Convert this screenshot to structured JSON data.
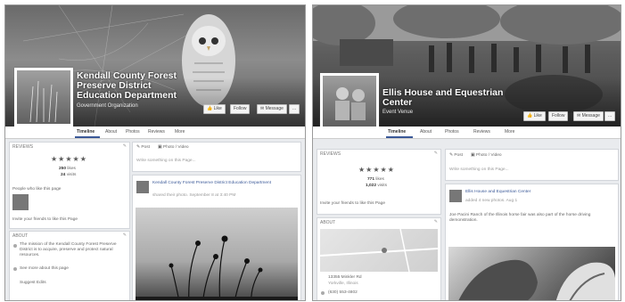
{
  "pageA": {
    "name": "Kendall County Forest Preserve District Education Department",
    "category": "Government Organization",
    "cover_buttons": {
      "like": "Like",
      "follow": "Follow",
      "message": "Message",
      "more": "..."
    },
    "tabs": [
      "Timeline",
      "About",
      "Photos",
      "Reviews",
      "More"
    ],
    "reviews": {
      "header": "REVIEWS",
      "stars": "★★★★★",
      "stat1_value": "250",
      "stat1_label": "likes",
      "stat2_value": "24",
      "stat2_label": "visits",
      "people_like": "People who like this page",
      "invite": "Invite your friends to like this Page"
    },
    "about": {
      "header": "ABOUT",
      "desc": "The mission of the Kendall County Forest Preserve District is to acquire, preserve and protect natural resources.",
      "link": "See more about this page",
      "suggest": "Suggest Edits"
    },
    "composer": {
      "post": "Post",
      "photo": "Photo / Video",
      "placeholder": "Write something on this Page..."
    },
    "post": {
      "author": "Kendall County Forest Preserve District Education Department",
      "meta": "shared their photo. September 8 at 3:40 PM"
    }
  },
  "pageB": {
    "name": "Ellis House and Equestrian Center",
    "category": "Event Venue",
    "cover_buttons": {
      "like": "Like",
      "follow": "Follow",
      "message": "Message",
      "more": "..."
    },
    "tabs": [
      "Timeline",
      "About",
      "Photos",
      "Reviews",
      "More"
    ],
    "reviews": {
      "header": "REVIEWS",
      "stars": "★★★★★",
      "stat1_value": "771",
      "stat1_label": "likes",
      "stat2_value": "1,022",
      "stat2_label": "visits",
      "invite": "Invite your friends to like this Page"
    },
    "about": {
      "header": "ABOUT",
      "address": "13355 Minkler Rd",
      "city": "Yorkville, Illinois",
      "phone": "(630) 553-4802"
    },
    "composer": {
      "post": "Post",
      "photo": "Photo / Video",
      "placeholder": "Write something on this Page..."
    },
    "post": {
      "author": "Ellis House and Equestrian Center",
      "meta": "added 4 new photos. Aug 1",
      "text": "Joe Pacini Ranch of the Illinois horse fair was also part of the horse driving demonstration."
    }
  }
}
